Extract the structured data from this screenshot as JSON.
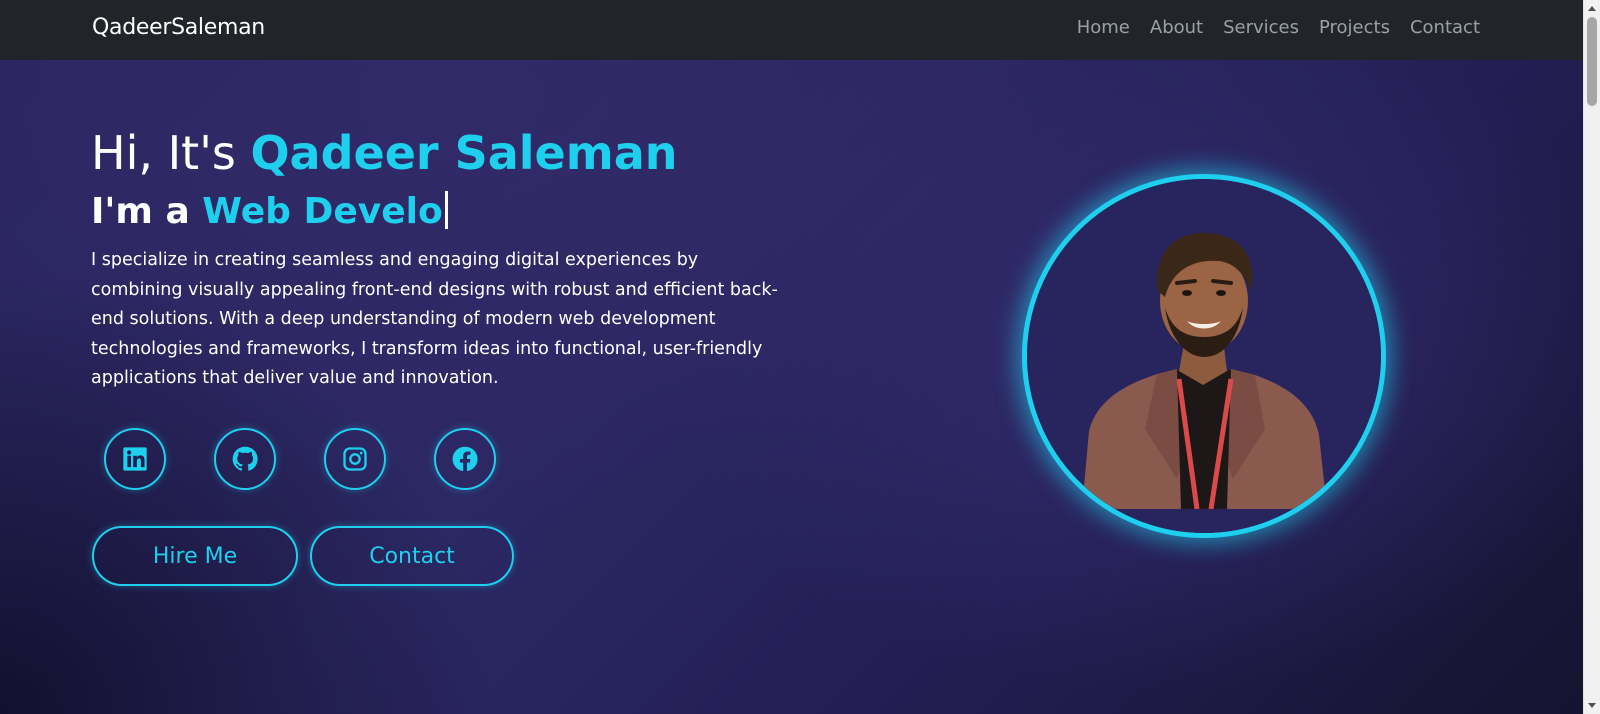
{
  "nav": {
    "brand": "QadeerSaleman",
    "links": [
      "Home",
      "About",
      "Services",
      "Projects",
      "Contact"
    ]
  },
  "hero": {
    "greeting": "Hi, It's ",
    "name": "Qadeer Saleman",
    "role_prefix": "I'm a ",
    "role_typed": "Web Develo",
    "bio": "I specialize in creating seamless and engaging digital experiences by combining visually appealing front-end designs with robust and efficient back-end solutions. With a deep understanding of modern web development technologies and frameworks, I transform ideas into functional, user-friendly applications that deliver value and innovation.",
    "socials": [
      "linkedin-icon",
      "github-icon",
      "instagram-icon",
      "facebook-icon"
    ],
    "buttons": {
      "hire": "Hire Me",
      "contact": "Contact"
    }
  },
  "colors": {
    "accent": "#1fd0ee",
    "navbar": "#212529",
    "background": "#2a2660"
  }
}
